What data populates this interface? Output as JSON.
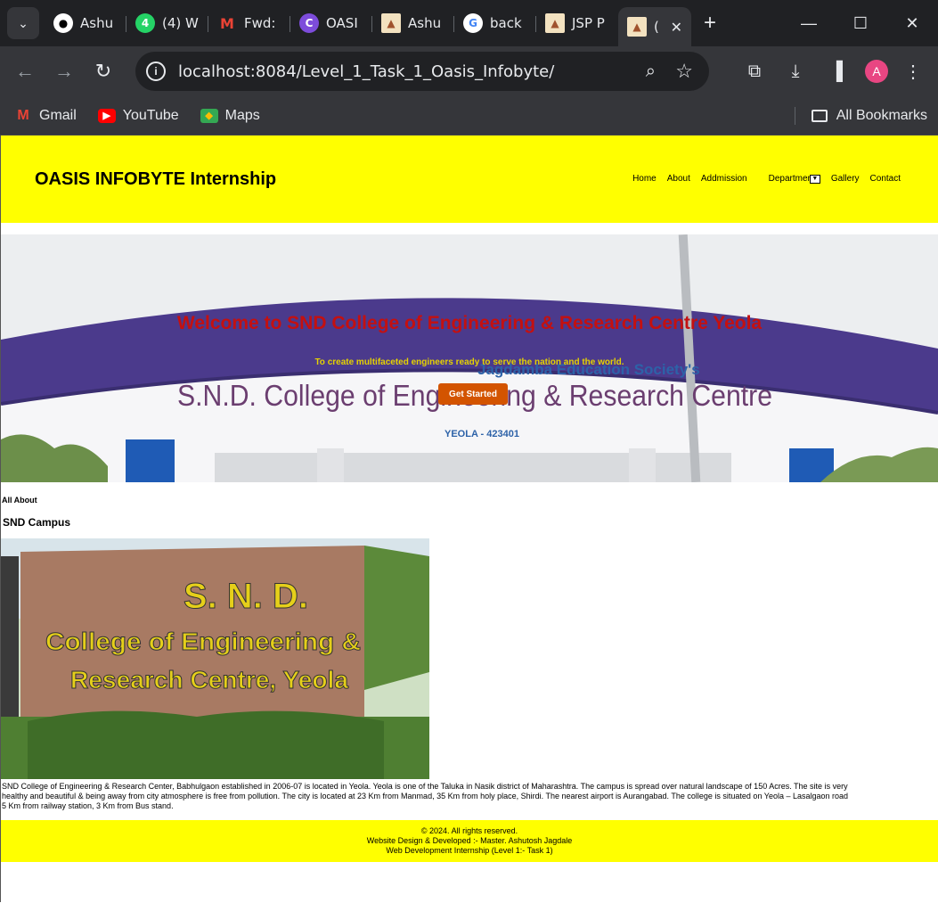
{
  "browser": {
    "tabs": [
      {
        "label": "Ashu",
        "icon": "github-icon"
      },
      {
        "label": "(4) W",
        "icon": "whatsapp-icon"
      },
      {
        "label": "Fwd:",
        "icon": "gmail-icon"
      },
      {
        "label": "OASI",
        "icon": "canva-icon"
      },
      {
        "label": "Ashu",
        "icon": "tomcat-icon"
      },
      {
        "label": "back",
        "icon": "google-icon"
      },
      {
        "label": "JSP P",
        "icon": "tomcat-icon"
      },
      {
        "label": "(",
        "icon": "tomcat-icon"
      }
    ],
    "url": "localhost:8084/Level_1_Task_1_Oasis_Infobyte/",
    "profile_initial": "A",
    "bookmarks": [
      {
        "label": "Gmail",
        "icon": "gmail-icon"
      },
      {
        "label": "YouTube",
        "icon": "youtube-icon"
      },
      {
        "label": "Maps",
        "icon": "maps-icon"
      }
    ],
    "all_bookmarks": "All Bookmarks"
  },
  "site": {
    "title": "OASIS INFOBYTE Internship",
    "nav": {
      "home": "Home",
      "about": "About",
      "admission": "Addmission",
      "department": "Department",
      "gallery": "Gallery",
      "contact": "Contact"
    },
    "hero": {
      "title": "Welcome to SND College of Engineering & Research Centre Yeola",
      "subtitle": "To create multifaceted engineers ready to serve the nation and the world.",
      "button": "Get Started",
      "building_sign_top": "Jagdamba Education Society's",
      "building_sign_main": "S.N.D. College of Engineering & Research Centre",
      "building_sign_pin": "YEOLA - 423401"
    },
    "about": {
      "label": "All About",
      "title": "SND Campus",
      "sign_line1": "S. N. D.",
      "sign_line2": "College of Engineering &",
      "sign_line3": "Research Centre, Yeola",
      "text_line1": "SND College of Engineering & Research Center, Babhulgaon established in 2006-07 is located in Yeola. Yeola is one of the Taluka in Nasik district of Maharashtra. The campus is spread over natural landscape of 150 Acres. The site is very",
      "text_line2": "healthy and beautiful & being away from city atmosphere is free from pollution. The city is located at 23 Km from Manmad, 35 Km from holy place, Shirdi. The nearest airport is Aurangabad. The college is situated on Yeola – Lasalgaon road",
      "text_line3": "5 Km from railway station, 3 Km from Bus stand."
    },
    "footer": {
      "line1": "© 2024. All rights reserved.",
      "line2": "Website Design & Developed :- Master. Ashutosh Jagdale",
      "line3": "Web Development Internship (Level 1:- Task 1)"
    }
  },
  "colors": {
    "header_bg": "#ffff00",
    "hero_title": "#c41010",
    "hero_subtitle": "#e6d200",
    "button_bg": "#d35400"
  }
}
